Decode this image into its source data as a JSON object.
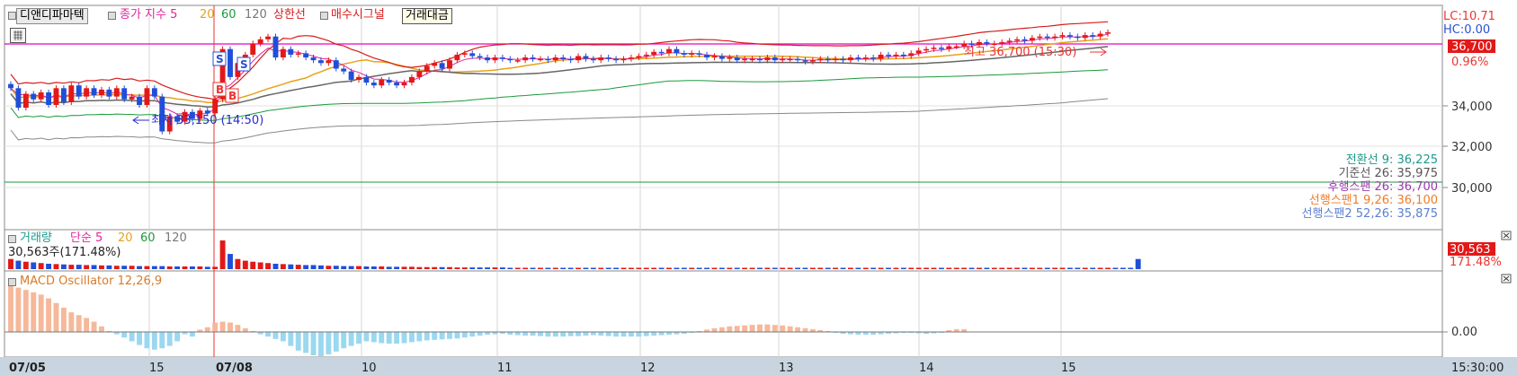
{
  "header": {
    "stock_name": "디앤디파마텍",
    "main_legend": [
      {
        "text": "종가 지수 5",
        "color": "#e0259d"
      },
      {
        "text": "20",
        "color": "#e8a21a"
      },
      {
        "text": "60",
        "color": "#1a9a3a"
      },
      {
        "text": "120",
        "color": "#777777"
      },
      {
        "text": "상한선",
        "color": "#d81b1b"
      },
      {
        "text": "매수시그널",
        "color": "#d81b1b"
      }
    ],
    "tooltip": "거래대금",
    "lc": "LC:10.71",
    "hc": "HC:0.00"
  },
  "price_axis": {
    "last_price": "36,700",
    "change_pct": "0.96%",
    "ticks": [
      "34,000",
      "32,000",
      "30,000"
    ]
  },
  "annotations": {
    "high": "최고 36,700 (15:30)",
    "low": "최저 33,150 (14:50)",
    "sell_marker": "S",
    "buy_marker": "B"
  },
  "ichimoku": [
    {
      "text": "전환선 9: 36,225",
      "color": "#1a9a8a"
    },
    {
      "text": "기준선 26: 35,975",
      "color": "#555555"
    },
    {
      "text": "후행스팬 26: 36,700",
      "color": "#9a3ab0"
    },
    {
      "text": "선행스팬1 9,26: 36,100",
      "color": "#f07c28"
    },
    {
      "text": "선행스팬2 52,26: 35,875",
      "color": "#5a7fd0"
    }
  ],
  "volume_panel": {
    "legend": [
      {
        "text": "거래량",
        "color": "#1a9a8a"
      },
      {
        "text": "단순 5",
        "color": "#e0259d"
      },
      {
        "text": "20",
        "color": "#e8a21a"
      },
      {
        "text": "60",
        "color": "#1a9a3a"
      },
      {
        "text": "120",
        "color": "#777777"
      }
    ],
    "current": "30,563주(171.48%)",
    "axis_value": "30,563",
    "axis_pct": "171.48%"
  },
  "macd_panel": {
    "legend": "MACD Oscillator 12,26,9",
    "zero_label": "0.00"
  },
  "time_axis": {
    "labels": [
      "07/05",
      "15",
      "07/08",
      "10",
      "11",
      "12",
      "13",
      "14",
      "15"
    ],
    "current_time": "15:30:00"
  },
  "chart_data": {
    "type": "candlestick",
    "price_range": [
      29700,
      37600
    ],
    "last": 36700,
    "high": 36700,
    "low": 33150,
    "guide_line": 36950,
    "support_line": 30200,
    "close": [
      34700,
      34000,
      34500,
      34300,
      34550,
      34100,
      34700,
      34200,
      34800,
      34400,
      34700,
      34450,
      34650,
      34400,
      34700,
      34300,
      34400,
      34100,
      34700,
      34400,
      33150,
      33700,
      33500,
      33850,
      33600,
      33900,
      33800,
      34300,
      36100,
      35100,
      35600,
      35900,
      36300,
      36450,
      36550,
      35800,
      36100,
      35900,
      35950,
      35800,
      35700,
      35600,
      35700,
      35400,
      35300,
      35000,
      35100,
      34900,
      34800,
      35000,
      34900,
      34800,
      34900,
      35100,
      35300,
      35500,
      35600,
      35400,
      35700,
      35900,
      35950,
      35850,
      35800,
      35700,
      35800,
      35750,
      35700,
      35700,
      35800,
      35750,
      35750,
      35700,
      35800,
      35750,
      35700,
      35850,
      35750,
      35700,
      35800,
      35750,
      35700,
      35750,
      35800,
      35850,
      35900,
      36000,
      35950,
      36100,
      35950,
      35900,
      35950,
      35900,
      35800,
      35850,
      35750,
      35800,
      35700,
      35750,
      35750,
      35700,
      35800,
      35700,
      35750,
      35750,
      35700,
      35650,
      35700,
      35750,
      35700,
      35750,
      35700,
      35800,
      35750,
      35800,
      35750,
      35900,
      35850,
      35900,
      35850,
      35950,
      36050,
      36100,
      36150,
      36100,
      36200,
      36200,
      36300,
      36250,
      36350,
      36300,
      36300,
      36350,
      36400,
      36450,
      36400,
      36500,
      36550,
      36500,
      36550,
      36600,
      36550,
      36500,
      36600,
      36550,
      36650,
      36700
    ],
    "volume": [
      30,
      25,
      22,
      20,
      18,
      16,
      15,
      14,
      13,
      13,
      12,
      12,
      11,
      11,
      10,
      10,
      10,
      9,
      9,
      9,
      9,
      8,
      8,
      8,
      8,
      8,
      7,
      7,
      85,
      45,
      30,
      25,
      22,
      20,
      18,
      16,
      15,
      14,
      13,
      12,
      12,
      11,
      10,
      10,
      9,
      9,
      9,
      8,
      8,
      8,
      7,
      7,
      7,
      7,
      6,
      6,
      6,
      6,
      6,
      5,
      5,
      5,
      5,
      5,
      5,
      5,
      4,
      4,
      4,
      4,
      4,
      4,
      4,
      4,
      4,
      4,
      4,
      4,
      4,
      4,
      4,
      4,
      4,
      4,
      4,
      4,
      4,
      4,
      4,
      4,
      4,
      4,
      4,
      4,
      4,
      4,
      4,
      4,
      4,
      4,
      4,
      4,
      4,
      4,
      4,
      4,
      4,
      4,
      4,
      4,
      4,
      4,
      4,
      4,
      4,
      4,
      4,
      4,
      4,
      4,
      4,
      4,
      4,
      4,
      4,
      4,
      4,
      4,
      4,
      4,
      4,
      4,
      4,
      4,
      4,
      4,
      4,
      4,
      4,
      4,
      4,
      4,
      4,
      4,
      4,
      4,
      4,
      4,
      4,
      30
    ],
    "macd": [
      1.0,
      0.95,
      0.9,
      0.85,
      0.8,
      0.72,
      0.62,
      0.52,
      0.42,
      0.36,
      0.3,
      0.22,
      0.12,
      0.02,
      -0.05,
      -0.12,
      -0.2,
      -0.28,
      -0.35,
      -0.38,
      -0.35,
      -0.3,
      -0.2,
      -0.05,
      -0.1,
      0.05,
      0.1,
      0.2,
      0.22,
      0.2,
      0.15,
      0.08,
      0.02,
      -0.05,
      -0.1,
      -0.15,
      -0.2,
      -0.3,
      -0.4,
      -0.45,
      -0.5,
      -0.52,
      -0.48,
      -0.42,
      -0.35,
      -0.3,
      -0.25,
      -0.2,
      -0.22,
      -0.24,
      -0.25,
      -0.25,
      -0.24,
      -0.22,
      -0.2,
      -0.18,
      -0.17,
      -0.16,
      -0.15,
      -0.14,
      -0.12,
      -0.1,
      -0.08,
      -0.06,
      -0.05,
      -0.04,
      -0.06,
      -0.07,
      -0.08,
      -0.08,
      -0.09,
      -0.1,
      -0.1,
      -0.1,
      -0.09,
      -0.09,
      -0.08,
      -0.07,
      -0.08,
      -0.09,
      -0.1,
      -0.1,
      -0.1,
      -0.1,
      -0.09,
      -0.08,
      -0.07,
      -0.06,
      -0.05,
      -0.04,
      -0.02,
      0.02,
      0.05,
      0.08,
      0.1,
      0.12,
      0.13,
      0.14,
      0.15,
      0.16,
      0.16,
      0.15,
      0.14,
      0.12,
      0.1,
      0.08,
      0.06,
      0.04,
      0.02,
      -0.02,
      -0.04,
      -0.05,
      -0.06,
      -0.06,
      -0.06,
      -0.05,
      -0.04,
      -0.03,
      -0.02,
      -0.02,
      -0.03,
      -0.04,
      -0.03,
      -0.02,
      0.04,
      0.06,
      0.06
    ]
  }
}
